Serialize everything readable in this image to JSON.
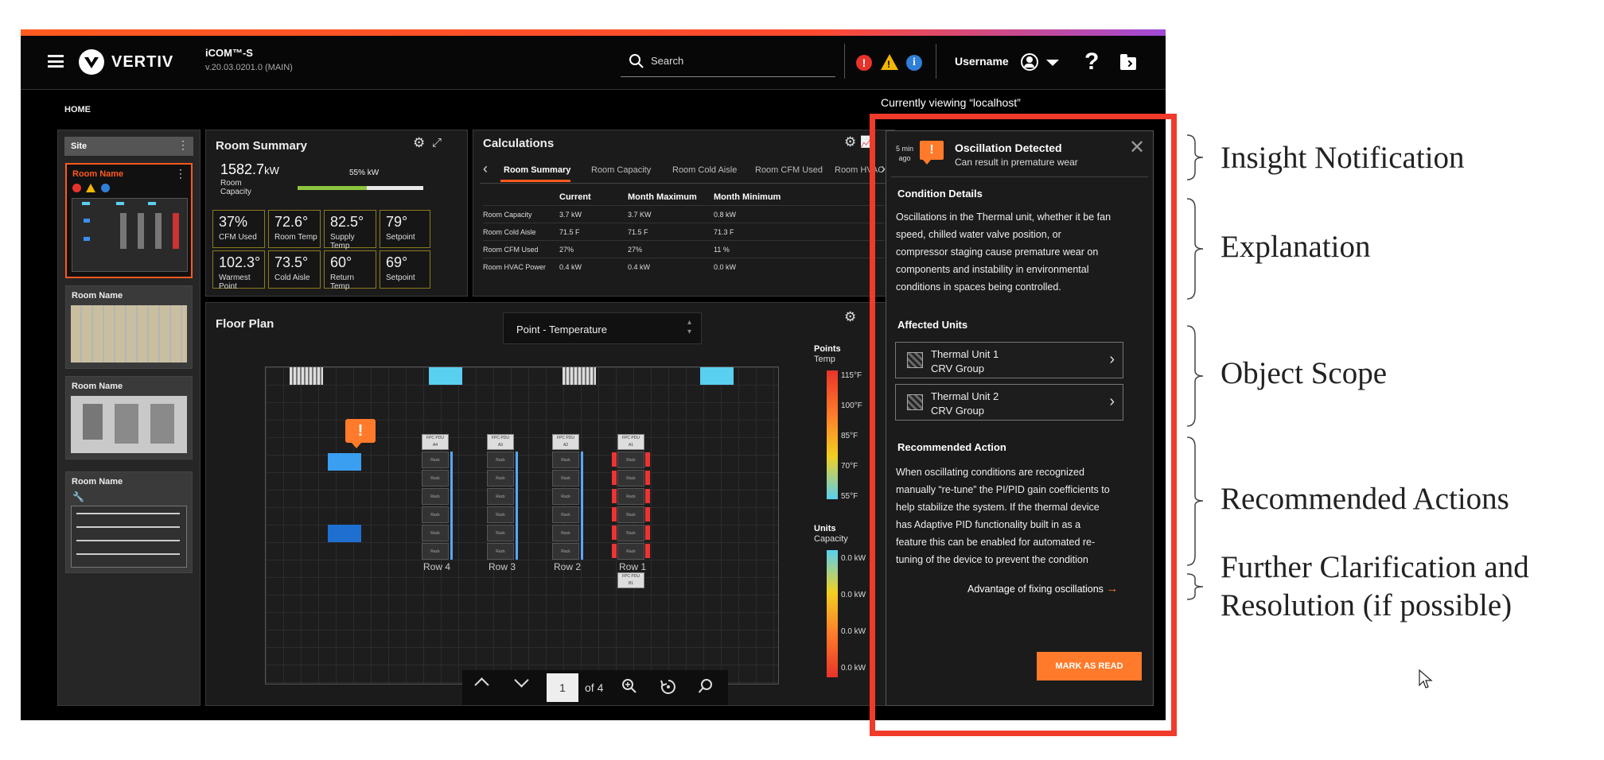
{
  "header": {
    "brand": "VERTIV",
    "app_name": "iCOM™-S",
    "version": "v.20.03.0201.0 (MAIN)",
    "search_placeholder": "Search",
    "username": "Username",
    "help_glyph": "?",
    "menu_icon": "hamburger-icon",
    "folder_icon": "folder-icon"
  },
  "breadcrumb": "HOME",
  "viewing": "Currently viewing “localhost”",
  "site_list": {
    "site_label": "Site",
    "items": [
      {
        "name": "Room Name"
      },
      {
        "name": "Room Name"
      },
      {
        "name": "Room Name"
      },
      {
        "name": "Room Name"
      }
    ]
  },
  "room_summary": {
    "title": "Room Summary",
    "capacity_value": "1582.7",
    "capacity_unit": "kW",
    "capacity_label": "Room Capacity",
    "capacity_bar_label": "55% kW",
    "capacity_fraction": 0.55,
    "metrics": [
      {
        "value": "37%",
        "label": "CFM Used"
      },
      {
        "value": "72.6°",
        "label": "Room Temp"
      },
      {
        "value": "82.5°",
        "label": "Supply Temp"
      },
      {
        "value": "79°",
        "label": "Setpoint"
      },
      {
        "value": "102.3°",
        "label": "Warmest Point"
      },
      {
        "value": "73.5°",
        "label": "Cold Aisle"
      },
      {
        "value": "60°",
        "label": "Return Temp"
      },
      {
        "value": "69°",
        "label": "Setpoint"
      }
    ]
  },
  "calculations": {
    "title": "Calculations",
    "tabs": [
      "Room Summary",
      "Room Capacity",
      "Room Cold Aisle",
      "Room CFM Used",
      "Room HVAC ..."
    ],
    "columns": [
      "",
      "Current",
      "Month Maximum",
      "Month Minimum"
    ],
    "rows": [
      [
        "Room Capacity",
        "3.7 kW",
        "3.7 KW",
        "0.8 kW"
      ],
      [
        "Room Cold Aisle",
        "71.5 F",
        "71.5 F",
        "71.3 F"
      ],
      [
        "Room CFM Used",
        "27%",
        "27%",
        "11 %"
      ],
      [
        "Room HVAC Power",
        "0.4 kW",
        "0.4 kW",
        "0.0 kW"
      ]
    ]
  },
  "floor_plan": {
    "title": "Floor Plan",
    "select_value": "Point - Temperature",
    "rows": [
      "Row 4",
      "Row 3",
      "Row 2",
      "Row 1"
    ],
    "rack_label": "Rack",
    "pdu_label": "FPC PDU",
    "pdu_ids": [
      "A4",
      "A3",
      "A2",
      "A1"
    ],
    "pdu_b_id": "B1",
    "page_current": "1",
    "page_total": "of 4",
    "points_legend": {
      "title": "Points",
      "subtitle": "Temp",
      "ticks": [
        "115°F",
        "100°F",
        "85°F",
        "70°F",
        "55°F"
      ]
    },
    "units_legend": {
      "title": "Units",
      "subtitle": "Capacity",
      "ticks": [
        "0.0 kW",
        "0.0 kW",
        "0.0 kW",
        "0.0 kW"
      ]
    }
  },
  "insight": {
    "time": "5 min ago",
    "title": "Oscillation Detected",
    "subtitle": "Can result in premature wear",
    "condition_heading": "Condition Details",
    "condition_lines": [
      "Oscillations in the Thermal unit, whether it be fan",
      "speed, chilled water valve position, or",
      "compressor staging cause premature wear on",
      "components and instability in environmental",
      "conditions in spaces being controlled."
    ],
    "affected_heading": "Affected Units",
    "units": [
      {
        "name": "Thermal Unit 1",
        "group": "CRV Group"
      },
      {
        "name": "Thermal Unit 2",
        "group": "CRV Group"
      }
    ],
    "action_heading": "Recommended Action",
    "action_lines": [
      "When oscillating conditions are recognized",
      "manually “re-tune” the PI/PID gain coefficients to",
      "help stabilize the system.  If the thermal device",
      "has Adaptive PID functionality built in as a",
      "feature this can be enabled for automated re-",
      "tuning of the device to prevent the condition"
    ],
    "link": "Advantage of fixing oscillations",
    "mark_read": "MARK AS READ"
  },
  "annotations": {
    "insight_notification": "Insight Notification",
    "explanation": "Explanation",
    "object_scope": "Object Scope",
    "recommended_actions": "Recommended Actions",
    "further_1": "Further Clarification and",
    "further_2": "Resolution (if possible)"
  },
  "colors": {
    "accent": "#ff5a1f",
    "highlight_box": "#f03a2a",
    "alert_red": "#e8332a",
    "alert_yellow": "#f2b705",
    "info_blue": "#2f7fd8",
    "metric_border": "#8a7a1e"
  }
}
